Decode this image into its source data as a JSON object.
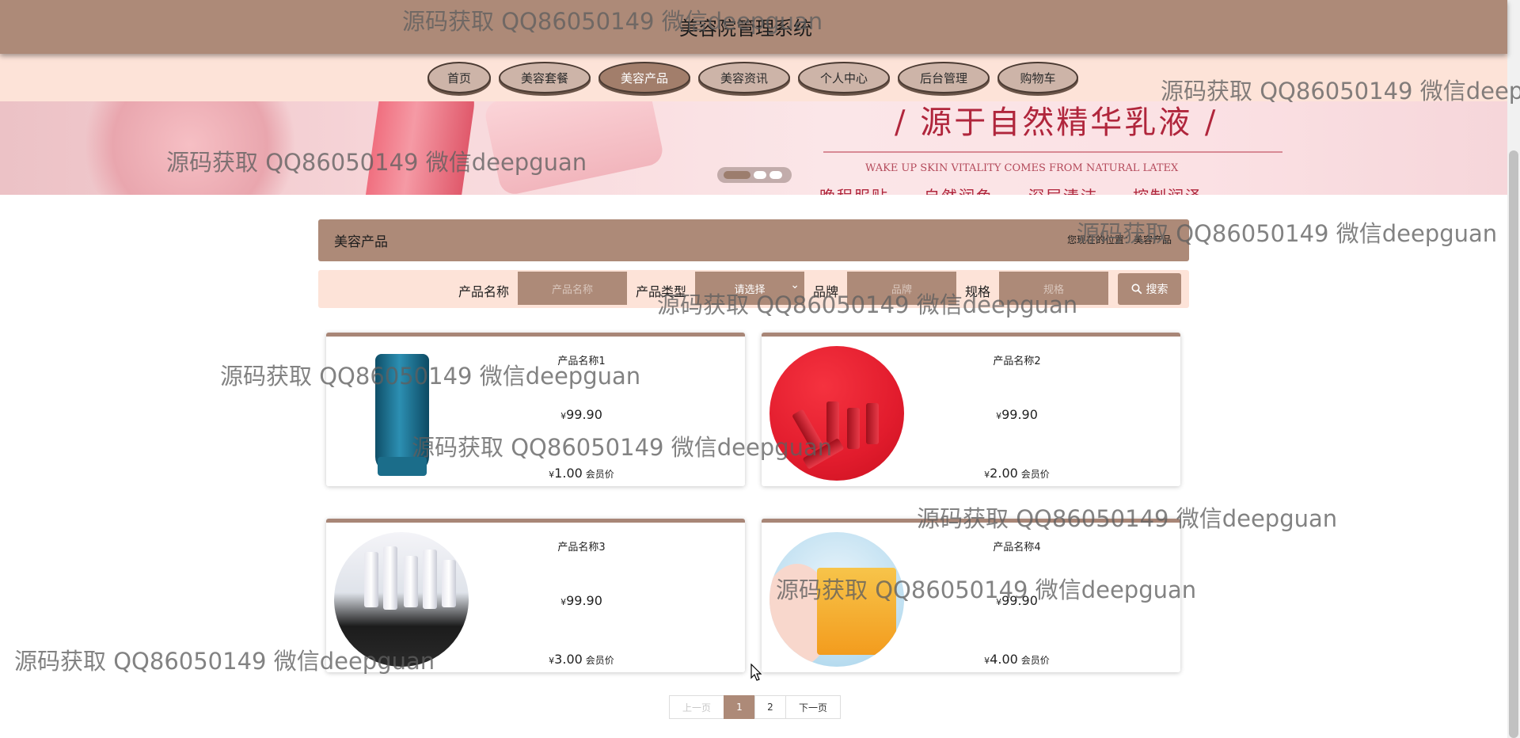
{
  "header": {
    "title": "美容院管理系统"
  },
  "nav": {
    "items": [
      "首页",
      "美容套餐",
      "美容产品",
      "美容资讯",
      "个人中心",
      "后台管理",
      "购物车"
    ],
    "active": "美容产品"
  },
  "banner": {
    "headline": "/ 源于自然精华乳液 /",
    "subtitle": "WAKE UP SKIN VITALITY COMES FROM NATURAL LATEX",
    "cut_text": "晚程服贴　　自然润色　　深层清洁　　控制润泽",
    "slide_count": 3,
    "active_slide": 1
  },
  "section": {
    "title": "美容产品",
    "breadcrumb": "您现在的位置：美容产品"
  },
  "search": {
    "name_label": "产品名称",
    "name_placeholder": "产品名称",
    "type_label": "产品类型",
    "type_value": "请选择",
    "brand_label": "品牌",
    "brand_placeholder": "品牌",
    "spec_label": "规格",
    "spec_placeholder": "规格",
    "button_label": "搜索"
  },
  "products": [
    {
      "name": "产品名称1",
      "price": "99.90",
      "member_price": "1.00",
      "member_tag": "会员价",
      "image": "cleanser-tube"
    },
    {
      "name": "产品名称2",
      "price": "99.90",
      "member_price": "2.00",
      "member_tag": "会员价",
      "image": "lipsticks"
    },
    {
      "name": "产品名称3",
      "price": "99.90",
      "member_price": "3.00",
      "member_tag": "会员价",
      "image": "cosmetics-shelf"
    },
    {
      "name": "产品名称4",
      "price": "99.90",
      "member_price": "4.00",
      "member_tag": "会员价",
      "image": "face-mask"
    }
  ],
  "currency_symbol": "¥",
  "pagination": {
    "prev": "上一页",
    "pages": [
      "1",
      "2"
    ],
    "current": "1",
    "next": "下一页"
  },
  "watermark": "源码获取 QQ86050149 微信deepguan",
  "colors": {
    "brand": "#ad8a78",
    "light": "#fde3d8",
    "accent_text": "#b0263c"
  }
}
